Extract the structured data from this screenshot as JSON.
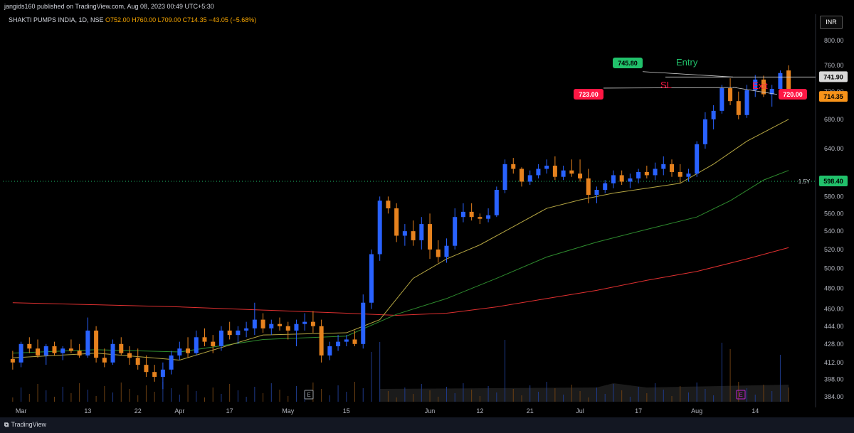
{
  "header": {
    "published": "jangids160 published on TradingView.com, Aug 08, 2023 00:49 UTC+5:30",
    "symbol": "SHAKTI PUMPS INDIA, 1D, NSE",
    "ohlc": "O752.00 H760.00 L709.00 C714.35 −43.05 (−5.68%)"
  },
  "currency_button": "INR",
  "footer": {
    "brand": "TradingView",
    "brand_icon": "tradingview-logo-icon"
  },
  "colors": {
    "up": "#2962ff",
    "down": "#e6821e",
    "sma_fast": "#b5a642",
    "sma_mid": "#2e8b2e",
    "sma_slow": "#e03030",
    "price_line": "#21c16b"
  },
  "chart_data": {
    "type": "candlestick",
    "title": "SHAKTI PUMPS INDIA, 1D, NSE",
    "y_ticks": [
      384,
      398,
      412,
      428,
      444,
      460,
      480,
      500,
      520,
      540,
      560,
      580,
      640,
      680,
      720,
      760,
      800
    ],
    "y_tick_labels": [
      "384.00",
      "398.00",
      "412.00",
      "428.00",
      "444.00",
      "460.00",
      "480.00",
      "500.00",
      "520.00",
      "540.00",
      "560.00",
      "580.00",
      "640.00",
      "680.00",
      "720.00",
      "760.00",
      "800.00"
    ],
    "y_scale": "log",
    "ylim": [
      380,
      820
    ],
    "x_labels": [
      "Mar",
      "13",
      "22",
      "Apr",
      "17",
      "May",
      "15",
      "Jun",
      "12",
      "21",
      "Jul",
      "17",
      "Aug",
      "14"
    ],
    "x_label_index": [
      1,
      9,
      15,
      20,
      26,
      33,
      40,
      50,
      56,
      62,
      68,
      75,
      82,
      89
    ],
    "n_slots": 94,
    "candles": [
      [
        0,
        415,
        422,
        406,
        412
      ],
      [
        1,
        412,
        430,
        408,
        428
      ],
      [
        2,
        428,
        434,
        420,
        424
      ],
      [
        3,
        424,
        432,
        416,
        418
      ],
      [
        4,
        418,
        428,
        410,
        426
      ],
      [
        5,
        426,
        430,
        418,
        420
      ],
      [
        6,
        420,
        426,
        414,
        424
      ],
      [
        7,
        424,
        432,
        420,
        422
      ],
      [
        8,
        422,
        428,
        416,
        418
      ],
      [
        9,
        418,
        452,
        416,
        440
      ],
      [
        10,
        440,
        444,
        412,
        416
      ],
      [
        11,
        416,
        424,
        408,
        412
      ],
      [
        12,
        412,
        432,
        410,
        428
      ],
      [
        13,
        428,
        434,
        418,
        420
      ],
      [
        14,
        420,
        426,
        410,
        416
      ],
      [
        15,
        416,
        424,
        406,
        410
      ],
      [
        16,
        410,
        418,
        400,
        404
      ],
      [
        17,
        404,
        410,
        396,
        400
      ],
      [
        18,
        400,
        412,
        390,
        406
      ],
      [
        19,
        406,
        422,
        402,
        418
      ],
      [
        20,
        418,
        430,
        414,
        424
      ],
      [
        21,
        424,
        434,
        416,
        420
      ],
      [
        22,
        420,
        440,
        418,
        434
      ],
      [
        23,
        434,
        442,
        426,
        430
      ],
      [
        24,
        430,
        436,
        420,
        426
      ],
      [
        25,
        426,
        444,
        422,
        440
      ],
      [
        26,
        440,
        448,
        432,
        436
      ],
      [
        27,
        436,
        444,
        428,
        440
      ],
      [
        28,
        440,
        448,
        434,
        442
      ],
      [
        29,
        442,
        466,
        436,
        450
      ],
      [
        30,
        450,
        456,
        438,
        442
      ],
      [
        31,
        442,
        450,
        436,
        446
      ],
      [
        32,
        446,
        452,
        440,
        444
      ],
      [
        33,
        444,
        448,
        432,
        440
      ],
      [
        34,
        440,
        450,
        426,
        446
      ],
      [
        35,
        446,
        456,
        440,
        448
      ],
      [
        36,
        448,
        458,
        438,
        444
      ],
      [
        37,
        444,
        450,
        412,
        418
      ],
      [
        38,
        418,
        430,
        414,
        426
      ],
      [
        39,
        426,
        436,
        422,
        430
      ],
      [
        40,
        430,
        436,
        426,
        432
      ],
      [
        41,
        432,
        440,
        426,
        428
      ],
      [
        42,
        428,
        474,
        424,
        466
      ],
      [
        43,
        466,
        520,
        460,
        515
      ],
      [
        44,
        515,
        580,
        508,
        575
      ],
      [
        45,
        575,
        580,
        560,
        566
      ],
      [
        46,
        566,
        572,
        528,
        535
      ],
      [
        47,
        535,
        548,
        524,
        540
      ],
      [
        48,
        540,
        552,
        524,
        530
      ],
      [
        49,
        530,
        556,
        520,
        548
      ],
      [
        50,
        548,
        560,
        510,
        520
      ],
      [
        51,
        520,
        530,
        506,
        512
      ],
      [
        52,
        512,
        532,
        506,
        524
      ],
      [
        53,
        524,
        566,
        520,
        556
      ],
      [
        54,
        556,
        572,
        550,
        562
      ],
      [
        55,
        562,
        572,
        552,
        556
      ],
      [
        56,
        556,
        560,
        548,
        554
      ],
      [
        57,
        554,
        566,
        550,
        558
      ],
      [
        58,
        558,
        592,
        556,
        588
      ],
      [
        59,
        588,
        626,
        584,
        620
      ],
      [
        60,
        620,
        628,
        608,
        614
      ],
      [
        61,
        614,
        616,
        592,
        598
      ],
      [
        62,
        598,
        612,
        594,
        606
      ],
      [
        63,
        606,
        620,
        602,
        614
      ],
      [
        64,
        614,
        626,
        608,
        618
      ],
      [
        65,
        618,
        630,
        600,
        604
      ],
      [
        66,
        604,
        618,
        600,
        612
      ],
      [
        67,
        612,
        626,
        604,
        608
      ],
      [
        68,
        608,
        626,
        598,
        602
      ],
      [
        69,
        602,
        614,
        572,
        582
      ],
      [
        70,
        582,
        592,
        572,
        588
      ],
      [
        71,
        588,
        600,
        584,
        596
      ],
      [
        72,
        596,
        612,
        590,
        606
      ],
      [
        73,
        606,
        612,
        594,
        598
      ],
      [
        74,
        598,
        608,
        590,
        602
      ],
      [
        75,
        602,
        614,
        596,
        610
      ],
      [
        76,
        610,
        618,
        602,
        606
      ],
      [
        77,
        606,
        622,
        600,
        614
      ],
      [
        78,
        614,
        630,
        606,
        620
      ],
      [
        79,
        620,
        626,
        604,
        610
      ],
      [
        80,
        610,
        620,
        596,
        604
      ],
      [
        81,
        604,
        614,
        598,
        608
      ],
      [
        82,
        608,
        650,
        604,
        646
      ],
      [
        83,
        646,
        690,
        640,
        680
      ],
      [
        84,
        680,
        700,
        666,
        692
      ],
      [
        85,
        692,
        730,
        688,
        725
      ],
      [
        86,
        725,
        740,
        700,
        706
      ],
      [
        87,
        706,
        720,
        680,
        686
      ],
      [
        88,
        686,
        730,
        682,
        722
      ],
      [
        89,
        722,
        745,
        712,
        738
      ],
      [
        90,
        738,
        744,
        712,
        716
      ],
      [
        91,
        716,
        730,
        698,
        724
      ],
      [
        92,
        724,
        752,
        710,
        748
      ],
      [
        93,
        752,
        760,
        709,
        714.35
      ]
    ],
    "sma_fast": [
      [
        0,
        416
      ],
      [
        10,
        420
      ],
      [
        20,
        414
      ],
      [
        30,
        436
      ],
      [
        40,
        438
      ],
      [
        44,
        450
      ],
      [
        48,
        490
      ],
      [
        52,
        510
      ],
      [
        56,
        525
      ],
      [
        60,
        545
      ],
      [
        64,
        566
      ],
      [
        68,
        576
      ],
      [
        72,
        584
      ],
      [
        76,
        590
      ],
      [
        80,
        596
      ],
      [
        84,
        620
      ],
      [
        88,
        650
      ],
      [
        93,
        680
      ]
    ],
    "sma_mid": [
      [
        0,
        420
      ],
      [
        10,
        423
      ],
      [
        20,
        421
      ],
      [
        30,
        432
      ],
      [
        40,
        435
      ],
      [
        46,
        455
      ],
      [
        52,
        470
      ],
      [
        58,
        490
      ],
      [
        64,
        512
      ],
      [
        70,
        528
      ],
      [
        76,
        542
      ],
      [
        82,
        556
      ],
      [
        86,
        575
      ],
      [
        90,
        600
      ],
      [
        93,
        612
      ]
    ],
    "sma_slow": [
      [
        0,
        466
      ],
      [
        10,
        464
      ],
      [
        20,
        462
      ],
      [
        30,
        459
      ],
      [
        40,
        456
      ],
      [
        46,
        454
      ],
      [
        52,
        456
      ],
      [
        58,
        462
      ],
      [
        64,
        470
      ],
      [
        70,
        478
      ],
      [
        76,
        488
      ],
      [
        82,
        497
      ],
      [
        88,
        510
      ],
      [
        93,
        522
      ]
    ],
    "annotations": [
      {
        "label": "Entry",
        "price": 745.8,
        "badge": "745.80",
        "color": "#21c16b"
      },
      {
        "label": "SL",
        "price": 723.0,
        "badge": "723.00",
        "color": "#ff1744"
      },
      {
        "label": "Exit",
        "price": 720.0,
        "badge": "720.00",
        "color": "#ff1744"
      }
    ],
    "price_labels": [
      {
        "text": "741.90",
        "price": 741.9,
        "kind": "last-close-line"
      },
      {
        "text": "714.35",
        "price": 714.35,
        "kind": "current"
      },
      {
        "text": "598.40",
        "price": 598.4,
        "kind": "horizontal-line"
      }
    ],
    "h_line_tag": "1.5Y",
    "volume_marker": "E"
  }
}
